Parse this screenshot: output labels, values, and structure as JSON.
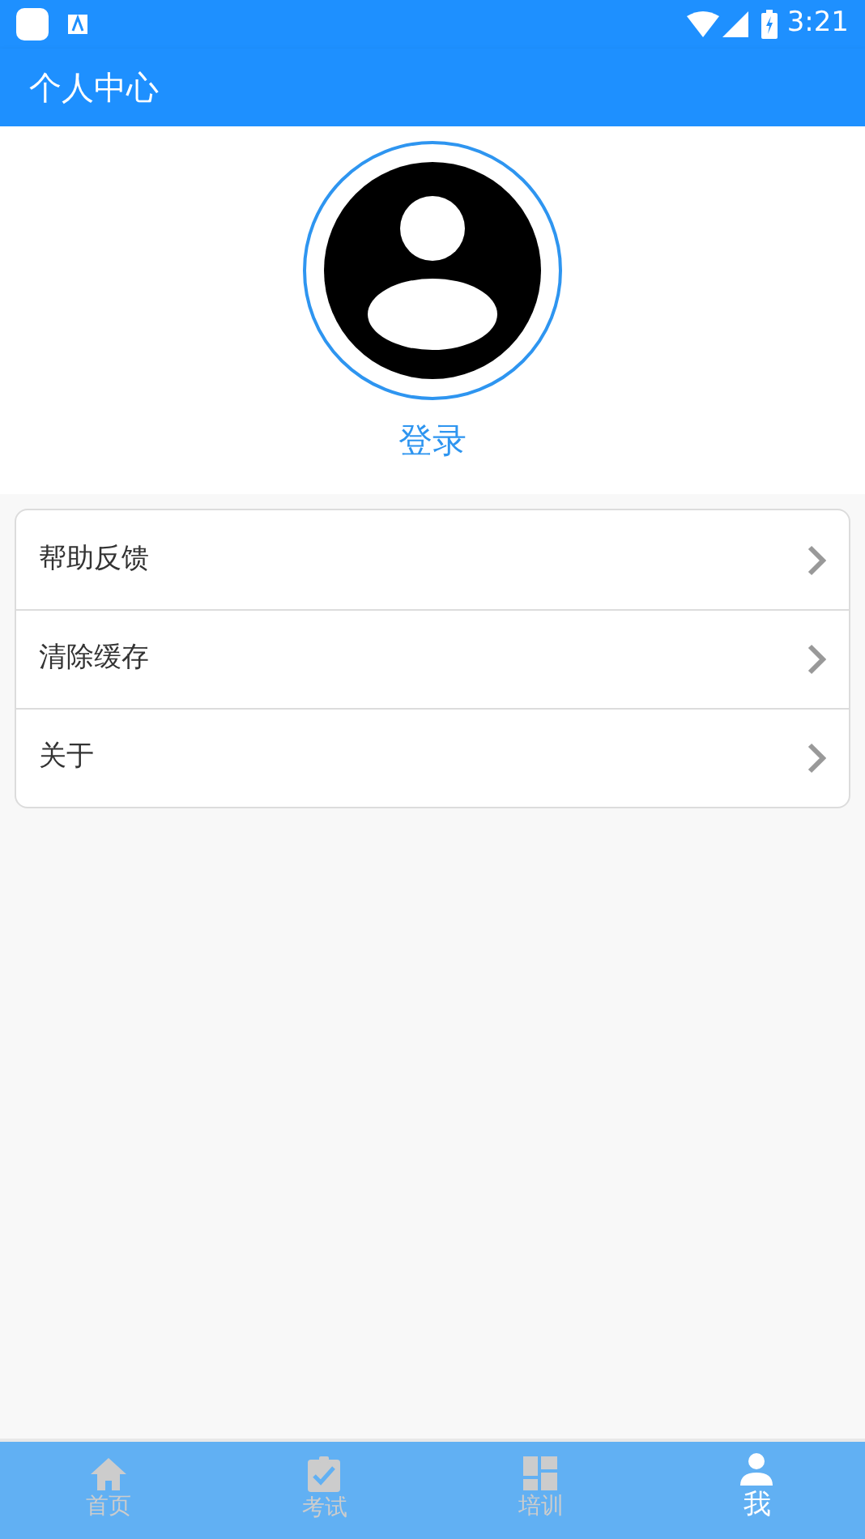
{
  "status_bar": {
    "time": "3:21"
  },
  "app_bar": {
    "title": "个人中心"
  },
  "profile": {
    "login": "登录"
  },
  "menu": [
    {
      "label": "帮助反馈"
    },
    {
      "label": "清除缓存"
    },
    {
      "label": "关于"
    }
  ],
  "tabs": [
    {
      "kind": "home",
      "label": "首页",
      "selected": false
    },
    {
      "kind": "exam",
      "label": "考试",
      "selected": false
    },
    {
      "kind": "training",
      "label": "培训",
      "selected": false
    },
    {
      "kind": "me",
      "label": "我",
      "selected": true
    }
  ]
}
